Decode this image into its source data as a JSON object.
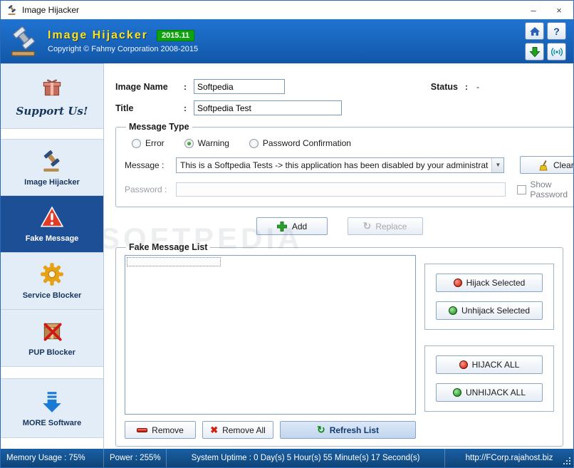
{
  "window": {
    "title": "Image Hijacker",
    "minimize_label": "–",
    "close_label": "×"
  },
  "header": {
    "app_name": "Image Hijacker",
    "version_badge": "2015.11",
    "copyright": "Copyright © Fahmy Corporation 2008-2015",
    "help_label": "?"
  },
  "sidebar": {
    "support": {
      "label": "Support Us!"
    },
    "items": [
      {
        "label": "Image Hijacker"
      },
      {
        "label": "Fake Message"
      },
      {
        "label": "Service Blocker"
      },
      {
        "label": "PUP Blocker"
      }
    ],
    "more": {
      "label": "MORE Software"
    }
  },
  "form": {
    "colon": ":",
    "image_name": {
      "label": "Image Name",
      "value": "Softpedia"
    },
    "status": {
      "label": "Status",
      "value": "-"
    },
    "title": {
      "label": "Title",
      "value": "Softpedia Test"
    },
    "message_type": {
      "legend": "Message Type",
      "options": [
        {
          "label": "Error"
        },
        {
          "label": "Warning"
        },
        {
          "label": "Password Confirmation"
        }
      ],
      "selected": "Warning"
    },
    "message": {
      "label": "Message :",
      "value": "This is a Softpedia Tests -> this application has been disabled by your administrat"
    },
    "clear_button": "Clear",
    "password": {
      "label": "Password :",
      "value": ""
    },
    "show_password_label": "Show Password",
    "add_button": "Add",
    "replace_button": "Replace"
  },
  "list_section": {
    "legend": "Fake Message List",
    "buttons": {
      "hijack_selected": "Hijack Selected",
      "unhijack_selected": "Unhijack Selected",
      "hijack_all": "HIJACK ALL",
      "unhijack_all": "UNHIJACK ALL",
      "remove": "Remove",
      "remove_all": "Remove All",
      "refresh": "Refresh List"
    }
  },
  "statusbar": {
    "memory": "Memory Usage : 75%",
    "power": "Power : 255%",
    "uptime": "System Uptime : 0 Day(s) 5 Hour(s) 55 Minute(s) 17 Second(s)",
    "url": "http://FCorp.rajahost.biz"
  },
  "watermark": {
    "text": "SOFTPEDIA"
  },
  "colors": {
    "header_blue": "#1f74d2",
    "active_item_blue": "#1d4f96",
    "badge_green": "#0da30d",
    "statusbar_blue": "#0e4478",
    "accent_yellow": "#ffe21a"
  }
}
